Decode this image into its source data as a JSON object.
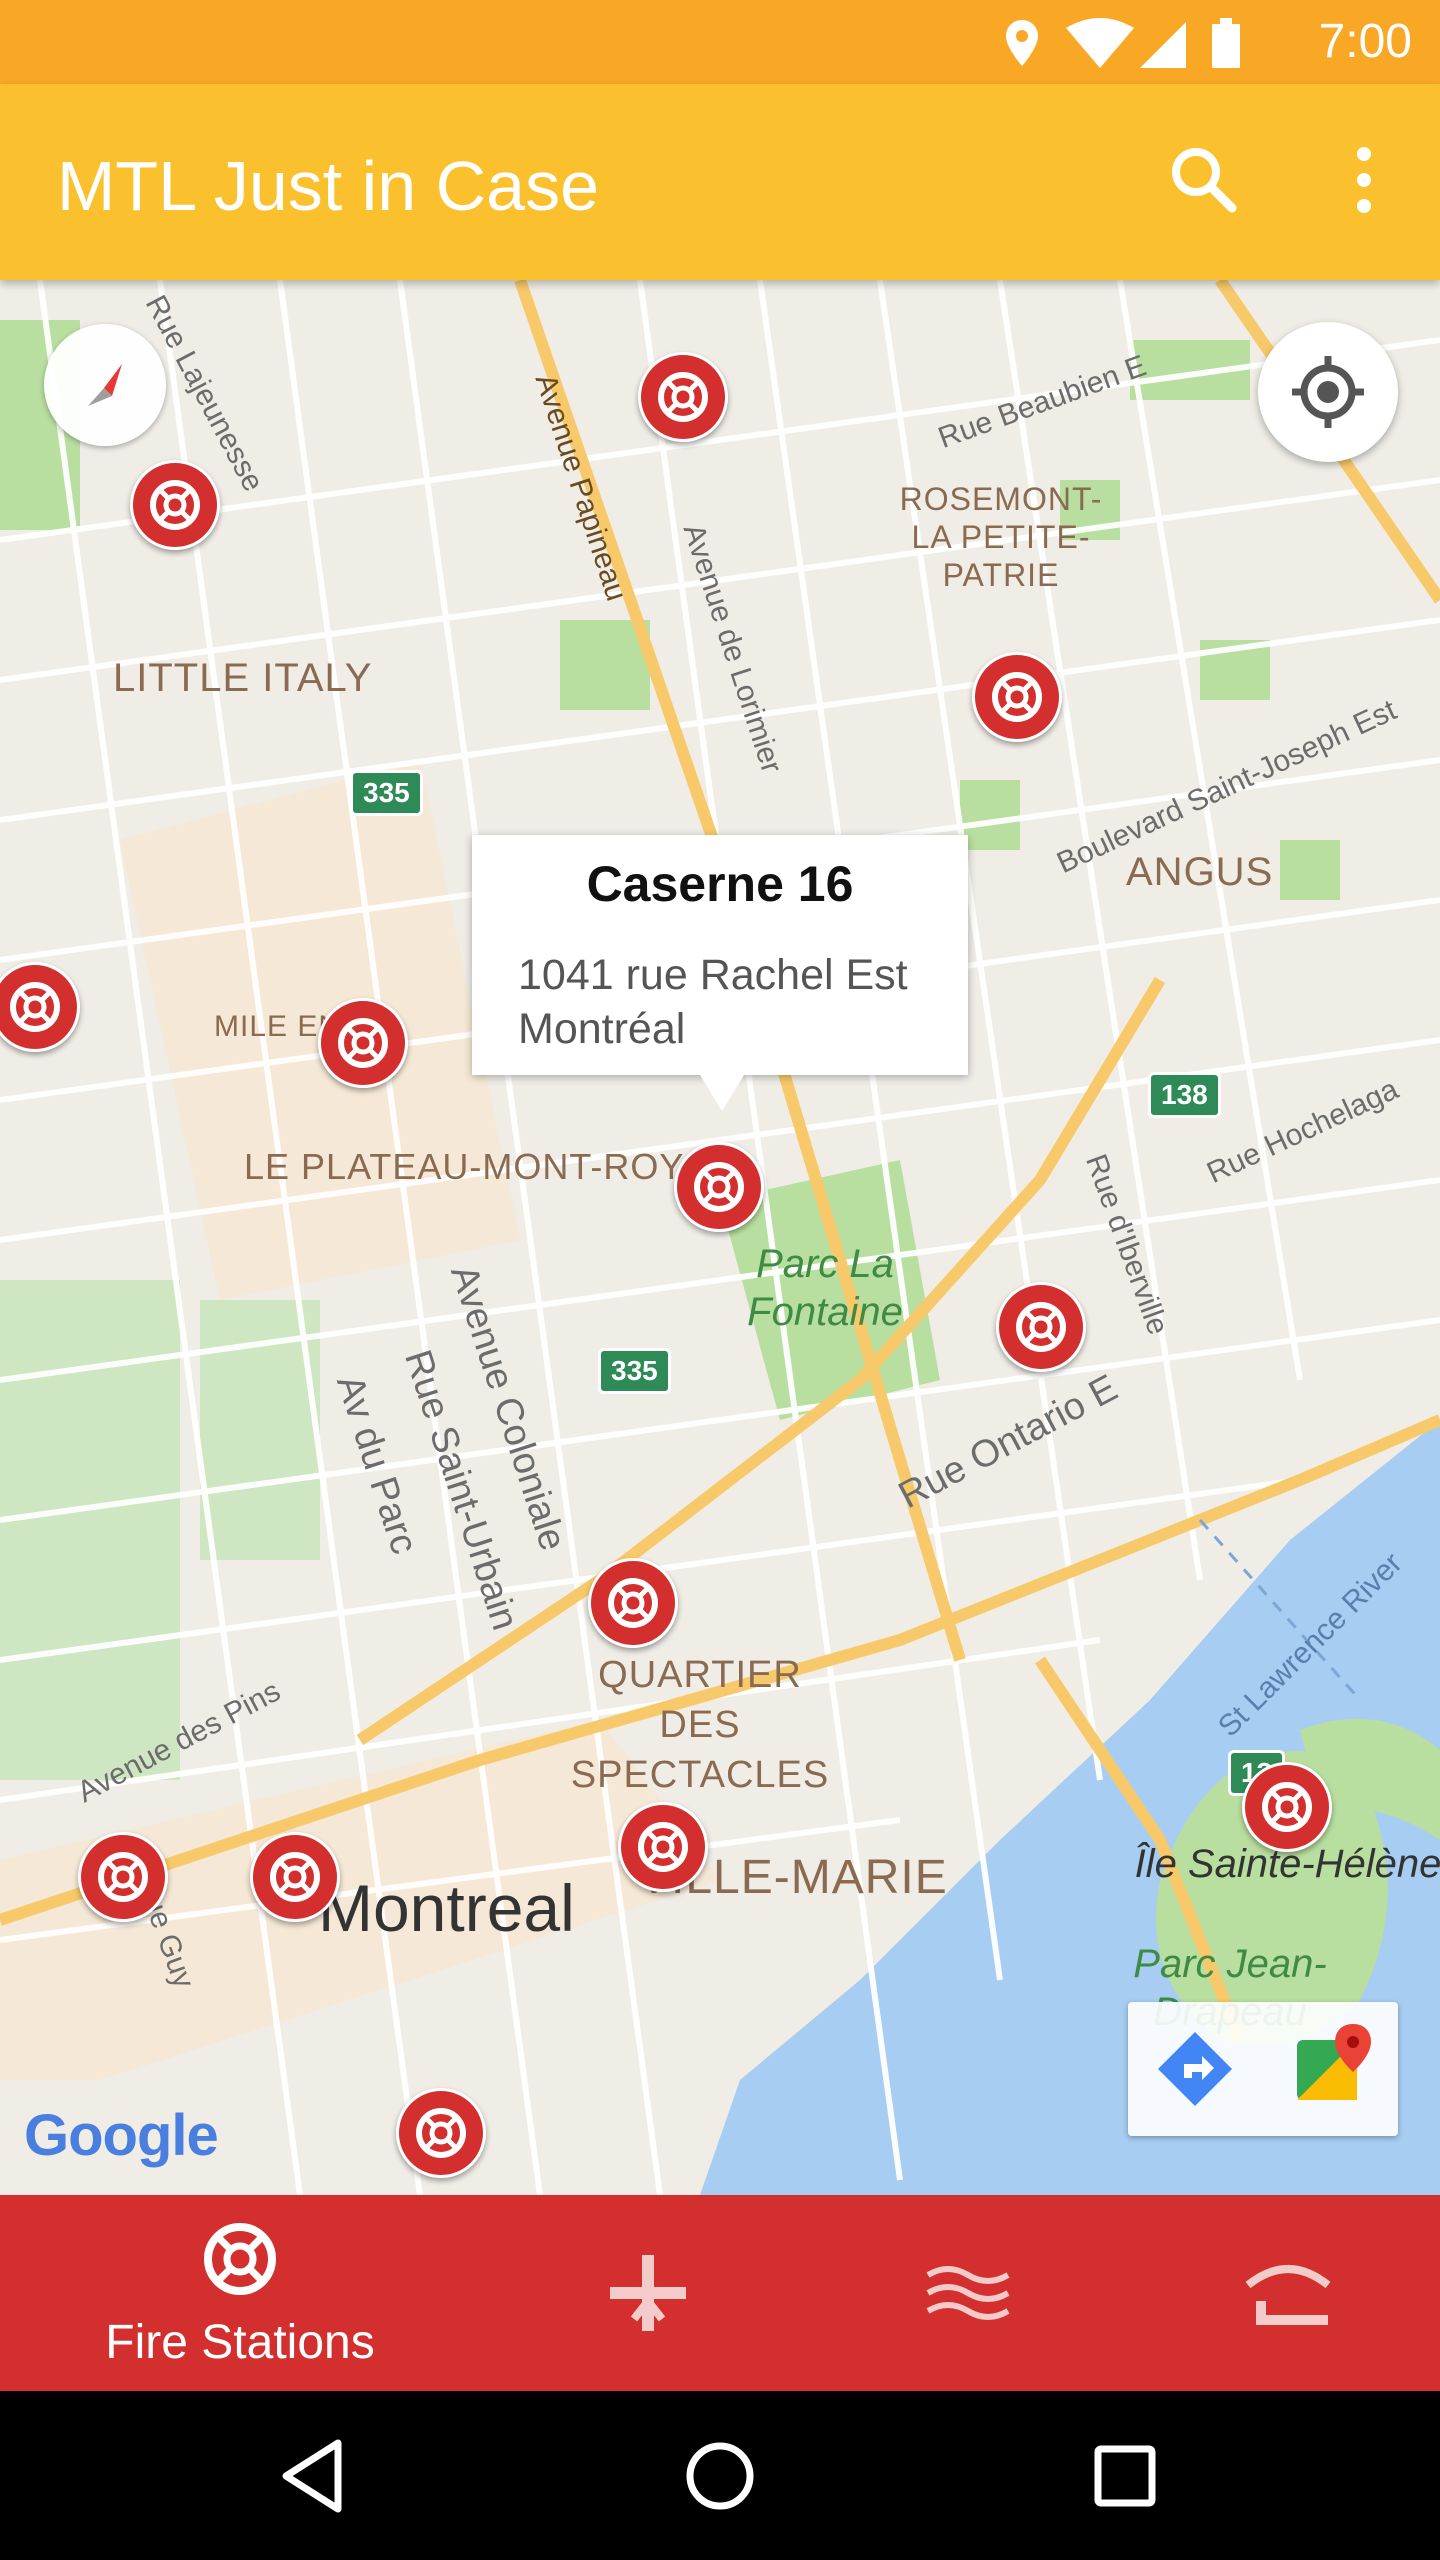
{
  "status_bar": {
    "time": "7:00",
    "icons": [
      "location-icon",
      "wifi-icon",
      "signal-icon",
      "battery-icon"
    ]
  },
  "app_bar": {
    "title": "MTL Just in Case",
    "search_icon": "search-icon",
    "more_icon": "more-vert-icon"
  },
  "map": {
    "neighbourhoods": [
      "LITTLE ITALY",
      "ROSEMONT-LA PETITE-PATRIE",
      "ANGUS",
      "MILE EN",
      "LE PLATEAU-MONT-ROYAL",
      "QUARTIER DES SPECTACLES",
      "VILLE-MARIE"
    ],
    "streets": [
      "Rue Lajeunesse",
      "Avenue Papineau",
      "Avenue de Lorimier",
      "Rue Beaubien E",
      "Boulevard Saint-Joseph Est",
      "Rue Hochelaga",
      "Rue d'Iberville",
      "Rue Ontario E",
      "Avenue Coloniale",
      "Rue Saint-Urbain",
      "Av du Parc",
      "Avenue des Pins",
      "St Lawrence River",
      "Rue Guy"
    ],
    "parks": [
      "Parc La Fontaine",
      "Parc Jean-Drapeau",
      "Île Sainte-Hélène"
    ],
    "city": "Montreal",
    "highway_shields": [
      "335",
      "335",
      "138",
      "13"
    ],
    "attribution": "Google",
    "colors": {
      "road": "#ffffff",
      "major_road": "#f7c96a",
      "park": "#b9dfa0",
      "water": "#a7cdf2",
      "marker": "#d32f2f"
    }
  },
  "info_window": {
    "title": "Caserne 16",
    "address_line1": "1041 rue Rachel Est",
    "address_line2": "Montréal"
  },
  "bottom_nav": {
    "items": [
      {
        "label": "Fire Stations",
        "icon": "fire-station-icon",
        "active": true
      },
      {
        "label": "",
        "icon": "hospital-icon",
        "active": false
      },
      {
        "label": "",
        "icon": "water-icon",
        "active": false
      },
      {
        "label": "",
        "icon": "shelter-icon",
        "active": false
      }
    ]
  },
  "system_nav": {
    "buttons": [
      "back-icon",
      "home-icon",
      "recents-icon"
    ]
  }
}
